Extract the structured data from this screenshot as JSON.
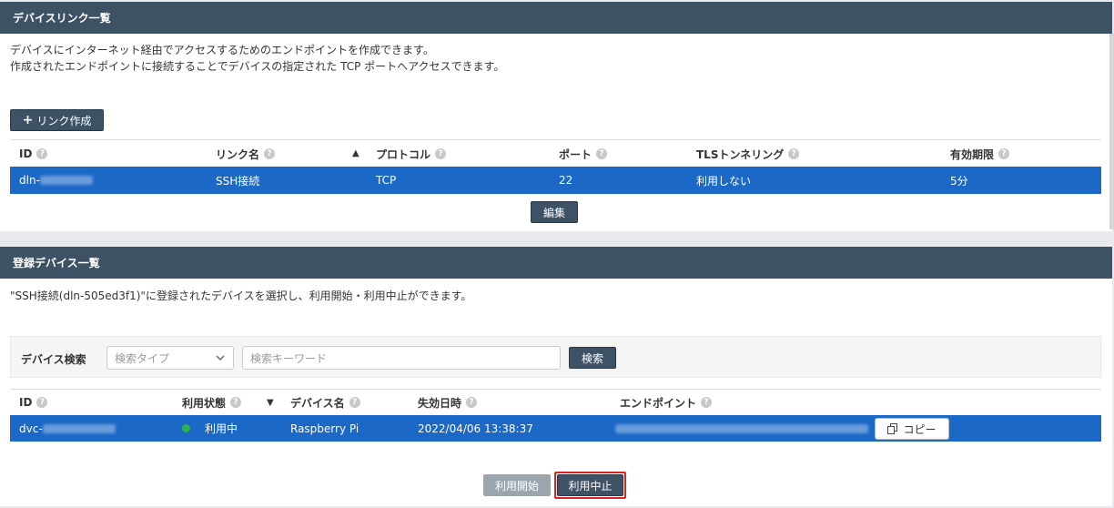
{
  "link_section": {
    "title": "デバイスリンク一覧",
    "description_line1": "デバイスにインターネット経由でアクセスするためのエンドポイントを作成できます。",
    "description_line2": "作成されたエンドポイントに接続することでデバイスの指定された TCP ポートへアクセスできます。",
    "create_button": "リンク作成",
    "columns": [
      "ID",
      "リンク名",
      "プロトコル",
      "ポート",
      "TLSトンネリング",
      "有効期限"
    ],
    "row": {
      "id_prefix": "dln-",
      "name": "SSH接続",
      "protocol": "TCP",
      "port": "22",
      "tls": "利用しない",
      "expiry": "5分"
    },
    "edit_button": "編集"
  },
  "device_section": {
    "title": "登録デバイス一覧",
    "description": "\"SSH接続(dln-505ed3f1)\"に登録されたデバイスを選択し、利用開始・利用中止ができます。",
    "search": {
      "label": "デバイス検索",
      "type_placeholder": "検索タイプ",
      "keyword_placeholder": "検索キーワード",
      "button": "検索"
    },
    "columns": [
      "ID",
      "利用状態",
      "デバイス名",
      "失効日時",
      "エンドポイント"
    ],
    "row": {
      "id_prefix": "dvc-",
      "status": "利用中",
      "device_name": "Raspberry Pi",
      "expires_at": "2022/04/06 13:38:37",
      "copy_button": "コピー"
    },
    "start_button": "利用開始",
    "stop_button": "利用中止"
  },
  "colors": {
    "header_bg": "#3e5266",
    "selected_row": "#1b68c7",
    "status_active": "#2bb24c",
    "highlight": "#e0201c"
  }
}
